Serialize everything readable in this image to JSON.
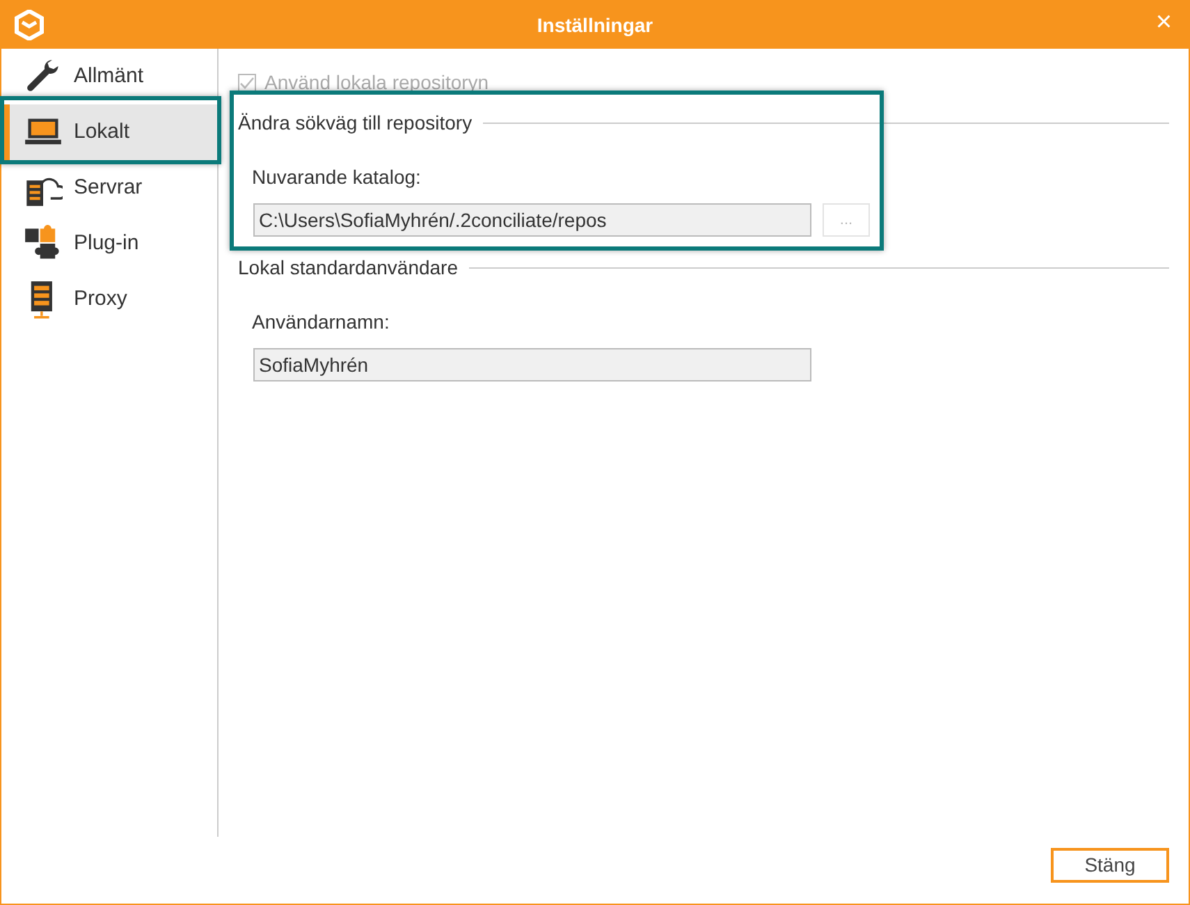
{
  "window": {
    "title": "Inställningar",
    "close": "×"
  },
  "sidebar": {
    "items": [
      {
        "label": "Allmänt",
        "selected": false,
        "highlighted": false
      },
      {
        "label": "Lokalt",
        "selected": true,
        "highlighted": true
      },
      {
        "label": "Servrar",
        "selected": false,
        "highlighted": false
      },
      {
        "label": "Plug-in",
        "selected": false,
        "highlighted": false
      },
      {
        "label": "Proxy",
        "selected": false,
        "highlighted": false
      }
    ]
  },
  "use_local_repositories": {
    "label": "Använd lokala repositoryn",
    "checked": true,
    "disabled": true
  },
  "sections": [
    {
      "title": "Ändra sökväg till repository",
      "field_label": "Nuvarande katalog:",
      "value": "C:\\Users\\SofiaMyhrén/.2conciliate/repos",
      "browse_button": "...",
      "highlighted": true
    },
    {
      "title": "Lokal standardanvändare",
      "field_label": "Användarnamn:",
      "value": "SofiaMyhrén",
      "highlighted": false
    }
  ],
  "buttons": [
    "Stäng"
  ]
}
